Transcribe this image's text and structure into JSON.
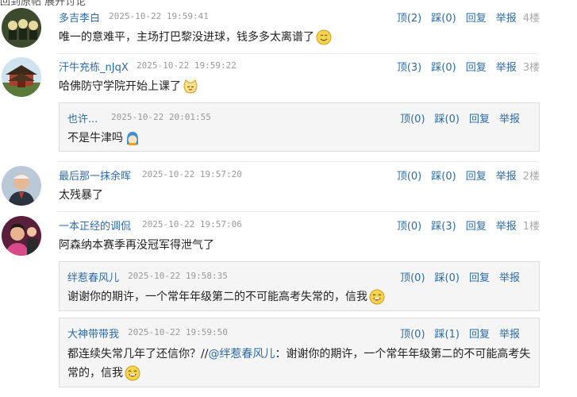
{
  "top_fragment": "回到原帖  展开讨论",
  "actions": {
    "up": "顶",
    "down": "踩",
    "reply": "回复",
    "report": "举报"
  },
  "comments": [
    {
      "author": "多吉李白",
      "time": "2025-10-22 19:59:41",
      "up": "(2)",
      "down": "(0)",
      "floor": "4楼",
      "text": "唯一的意难平，主场打巴黎没进球，钱多多太离谱了",
      "emoji": "smile-sweat-icon"
    },
    {
      "author": "汗牛充栋_nJqX",
      "time": "2025-10-22 19:59:22",
      "up": "(3)",
      "down": "(0)",
      "floor": "3楼",
      "text": "哈佛防守学院开始上课了",
      "emoji": "cat-face-icon",
      "replies": [
        {
          "author": "也许...",
          "time": "2025-10-22 20:01:55",
          "up": "(0)",
          "down": "(0)",
          "text": "不是牛津吗",
          "emoji": "blue-hair-girl-icon"
        }
      ]
    },
    {
      "author": "最后那一抹余晖",
      "time": "2025-10-22 19:57:20",
      "up": "(0)",
      "down": "(0)",
      "floor": "2楼",
      "text": "太残暴了"
    },
    {
      "author": "一本正经的调侃",
      "time": "2025-10-22 19:57:06",
      "up": "(0)",
      "down": "(3)",
      "floor": "1楼",
      "text": "阿森纳本赛季再没冠军得泄气了",
      "replies": [
        {
          "author": "绊惹春风儿",
          "time": "2025-10-22 19:58:35",
          "up": "(0)",
          "down": "(0)",
          "text": "谢谢你的期许，一个常年年级第二的不可能高考失常的，信我",
          "emoji": "laughing-face-icon"
        },
        {
          "author": "大神带带我",
          "time": "2025-10-22 19:59:50",
          "up": "(0)",
          "down": "(1)",
          "text_prefix": "都连续失常几年了还信你？//",
          "quote_user": "@绊惹春风儿",
          "text_line1": "：谢谢你的期许，一个常年年级第二的不可能高考失",
          "text_line2": "常的，信我",
          "emoji": "laughing-face-icon"
        }
      ]
    }
  ],
  "colors": {
    "link": "#2b6aa6",
    "meta": "#999999",
    "reply_bg": "#f5f5f5",
    "reply_border": "#dddddd"
  }
}
